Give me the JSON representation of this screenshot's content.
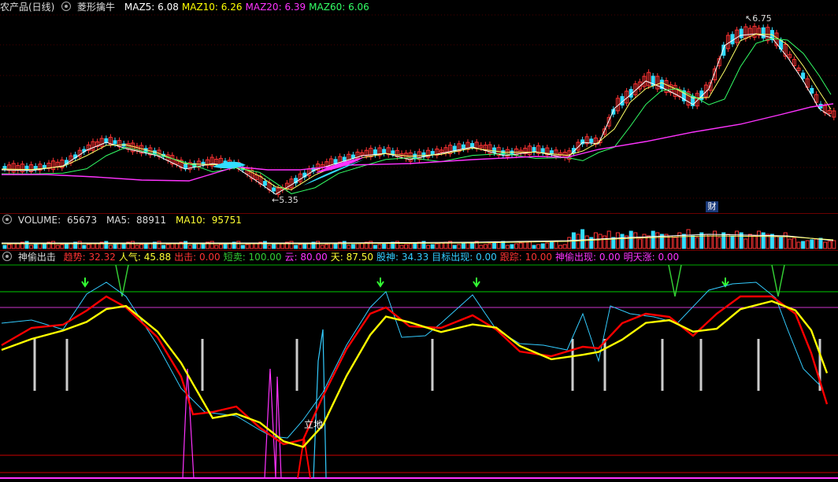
{
  "main": {
    "title": "农产品(日线)",
    "indicator": "菱形擒牛",
    "maz": [
      {
        "label": "MAZ5: ",
        "value": "6.08",
        "color": "#ffffff"
      },
      {
        "label": "MAZ10: ",
        "value": "6.26",
        "color": "#ffff00"
      },
      {
        "label": "MAZ20: ",
        "value": "6.39",
        "color": "#ff33ff"
      },
      {
        "label": "MAZ60: ",
        "value": "6.06",
        "color": "#33ff66"
      }
    ],
    "high_label": "6.75",
    "low_label": "5.35",
    "badge": "财"
  },
  "volume": {
    "label": "VOLUME: ",
    "value": "65673",
    "ma5_label": "MA5: ",
    "ma5": "88911",
    "ma10_label": "MA10: ",
    "ma10": "95751"
  },
  "lower": {
    "title": "神偷出击",
    "items": [
      {
        "label": "趋势: ",
        "value": "32.32",
        "color": "#ff3333"
      },
      {
        "label": "人气: ",
        "value": "45.88",
        "color": "#ffff33"
      },
      {
        "label": "出击: ",
        "value": "0.00",
        "color": "#ff3333"
      },
      {
        "label": "短卖: ",
        "value": "100.00",
        "color": "#33cc33"
      },
      {
        "label": "云: ",
        "value": "80.00",
        "color": "#ff33ff"
      },
      {
        "label": "天: ",
        "value": "87.50",
        "color": "#ffff33"
      },
      {
        "label": "股神: ",
        "value": "34.33",
        "color": "#33ccff"
      },
      {
        "label": "目标出现: ",
        "value": "0.00",
        "color": "#33ccff"
      },
      {
        "label": "跟踪: ",
        "value": "10.00",
        "color": "#ff3333"
      },
      {
        "label": "神偷出现: ",
        "value": "0.00",
        "color": "#ff33ff"
      },
      {
        "label": "明天涨: ",
        "value": "0.00",
        "color": "#ff33ff"
      }
    ],
    "annotation": "立地"
  },
  "colors": {
    "up": "#ff3333",
    "down": "#33ddff",
    "ma5": "#ffffff",
    "ma10": "#ffff66",
    "ma20": "#33ff66",
    "ma60": "#ff33ff",
    "trend": "#ff0000",
    "popularity": "#ffff00",
    "stockgod": "#33ccff"
  }
}
